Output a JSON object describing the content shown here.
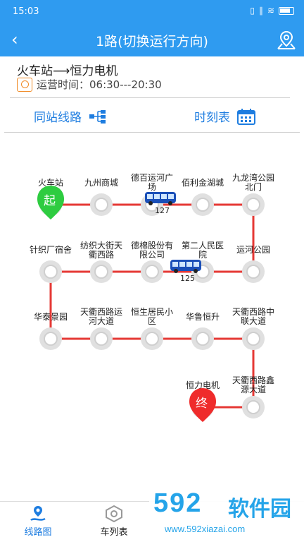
{
  "status_bar": {
    "time": "15:03",
    "signal": "∥",
    "wifi": "≋"
  },
  "header": {
    "back": "‹",
    "title": "1路(切换运行方向)"
  },
  "route_info": {
    "name": "火车站⟶恒力电机",
    "operating_time": "运营时间：06:30---20:30"
  },
  "tabs": {
    "same_station": "同站线路",
    "timetable": "时刻表"
  },
  "start_marker": "起",
  "end_marker": "终",
  "stops": [
    "火车站",
    "九州商城",
    "德百运河广场",
    "佰利金湖城",
    "九龙湾公园北门",
    "运河公园",
    "第二人民医院",
    "德棉股份有限公司",
    "纺织大街天衢西路",
    "针织厂宿舍",
    "华泰景园",
    "天衢西路运河大道",
    "恒生居民小区",
    "华鲁恒升",
    "天衢西路中联大道",
    "天衢西路鑫源大道",
    "恒力电机"
  ],
  "buses": [
    {
      "id": "127"
    },
    {
      "id": "125"
    }
  ],
  "bottom_nav": {
    "route_map": "线路图",
    "bus_list": "车列表"
  },
  "watermark": {
    "brand": "592",
    "soft": "软件园",
    "url": "www.592xiazai.com"
  },
  "colors": {
    "primary": "#2f9bf0",
    "line": "#e53935",
    "start": "#2ecc40",
    "end": "#ef2b2b",
    "link": "#1e7de0"
  }
}
